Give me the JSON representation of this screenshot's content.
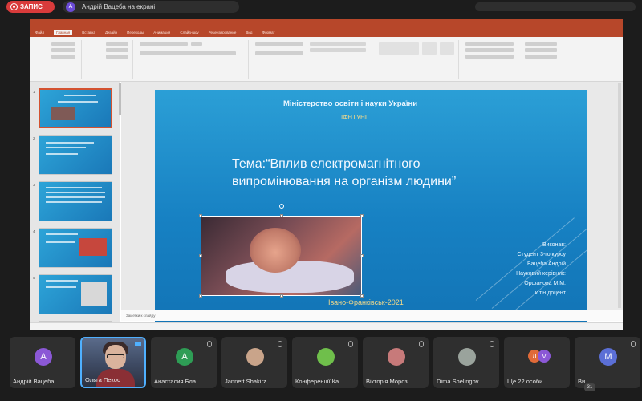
{
  "topbar": {
    "record_label": "ЗАПИС",
    "sharer_initial": "А",
    "sharer_text": "Андрій Вацеба на екрані"
  },
  "powerpoint": {
    "slide": {
      "ministry": "Міністерство освіти і науки України",
      "university": "ІФНТУНГ",
      "topic_line1": "Тема:“Вплив електромагнітного",
      "topic_line2": "випромінювання на організм   людини”",
      "author_lines": [
        "Виконав:",
        "Студент 3-го курсу",
        "Вацеба Андрій",
        "Науковий керівник:",
        "Орфанова М.М.",
        "к.т.н.доцент"
      ],
      "city_year": "Івано-Франківськ-2021"
    },
    "thumb_numbers": [
      "1",
      "2",
      "3",
      "4",
      "5"
    ],
    "notes_placeholder": "Заметки к слайду"
  },
  "participants": [
    {
      "name": "Андрій Вацеба",
      "initial": "А",
      "color": "#8b58d6",
      "type": "avatar"
    },
    {
      "name": "Ольга Пекос",
      "type": "camera"
    },
    {
      "name": "Анастасия Бла...",
      "initial": "А",
      "color": "#2e9d55",
      "type": "avatar"
    },
    {
      "name": "Jannett Shakirz...",
      "type": "photo",
      "color": "#c9a48a"
    },
    {
      "name": "Конференції Ка...",
      "type": "photo",
      "color": "#6fbf4b"
    },
    {
      "name": "Вікторія Мороз",
      "type": "photo",
      "color": "#c77a7a"
    },
    {
      "name": "Dima Shelingov...",
      "type": "photo",
      "color": "#9aa39c"
    },
    {
      "name": "Ще 22 особи",
      "type": "more",
      "i1": "Л",
      "i2": "V"
    },
    {
      "name": "Ви",
      "initial": "M",
      "color": "#5b6fd6",
      "type": "avatar"
    }
  ],
  "people_count": "31"
}
